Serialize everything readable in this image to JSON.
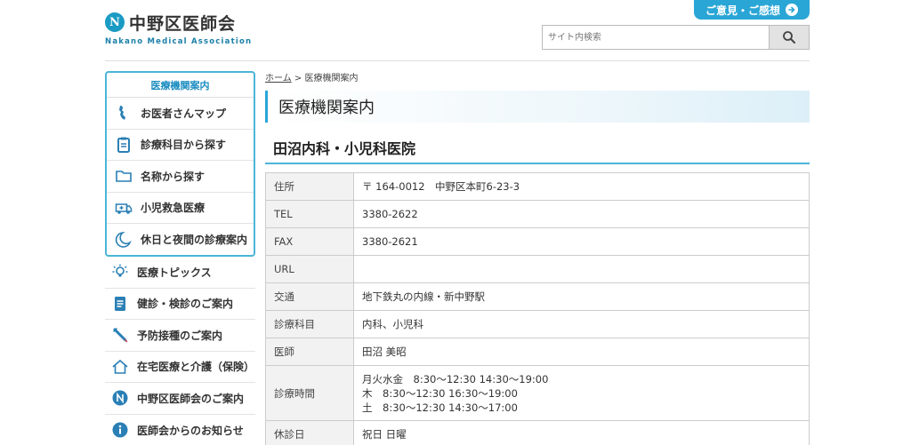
{
  "header": {
    "logo_mark": "N",
    "logo_title": "中野区医師会",
    "logo_subtitle": "Nakano Medical Association",
    "opinion_button": "ご意見・ご感想",
    "search_placeholder": "サイト内検索"
  },
  "sidebar": {
    "boxed_title": "医療機関案内",
    "boxed_items": [
      {
        "label": "お医者さんマップ",
        "icon": "map-icon"
      },
      {
        "label": "診療科目から探す",
        "icon": "clipboard-icon"
      },
      {
        "label": "名称から探す",
        "icon": "folder-icon"
      },
      {
        "label": "小児救急医療",
        "icon": "ambulance-icon"
      },
      {
        "label": "休日と夜間の診療案内",
        "icon": "moon-icon"
      }
    ],
    "items": [
      {
        "label": "医療トピックス",
        "icon": "lightbulb-icon"
      },
      {
        "label": "健診・検診のご案内",
        "icon": "checklist-icon"
      },
      {
        "label": "予防接種のご案内",
        "icon": "syringe-icon"
      },
      {
        "label": "在宅医療と介護（保険）",
        "icon": "house-icon"
      },
      {
        "label": "中野区医師会のご案内",
        "icon": "association-logo-icon"
      },
      {
        "label": "医師会からのお知らせ",
        "icon": "info-icon"
      }
    ]
  },
  "breadcrumb": {
    "home": "ホーム",
    "separator": ">",
    "current": "医療機関案内"
  },
  "page_title": "医療機関案内",
  "clinic": {
    "name": "田沼内科・小児科医院",
    "rows": [
      {
        "key": "住所",
        "value": "〒 164-0012　中野区本町6-23-3"
      },
      {
        "key": "TEL",
        "value": "3380-2622"
      },
      {
        "key": "FAX",
        "value": "3380-2621"
      },
      {
        "key": "URL",
        "value": ""
      },
      {
        "key": "交通",
        "value": "地下鉄丸の内線・新中野駅"
      },
      {
        "key": "診療科目",
        "value": "内科、小児科"
      },
      {
        "key": "医師",
        "value": "田沼 美昭"
      }
    ],
    "hours_key": "診療時間",
    "hours": [
      "月火水金　8:30～12:30 14:30～19:00",
      "木　8:30～12:30 16:30～19:00",
      "土　8:30～12:30 14:30～17:00"
    ],
    "closed_key": "休診日",
    "closed_value": "祝日 日曜"
  },
  "colors": {
    "accent": "#2aa6d6",
    "border_accent": "#4bb5d8",
    "logo": "#1a9bc4"
  }
}
